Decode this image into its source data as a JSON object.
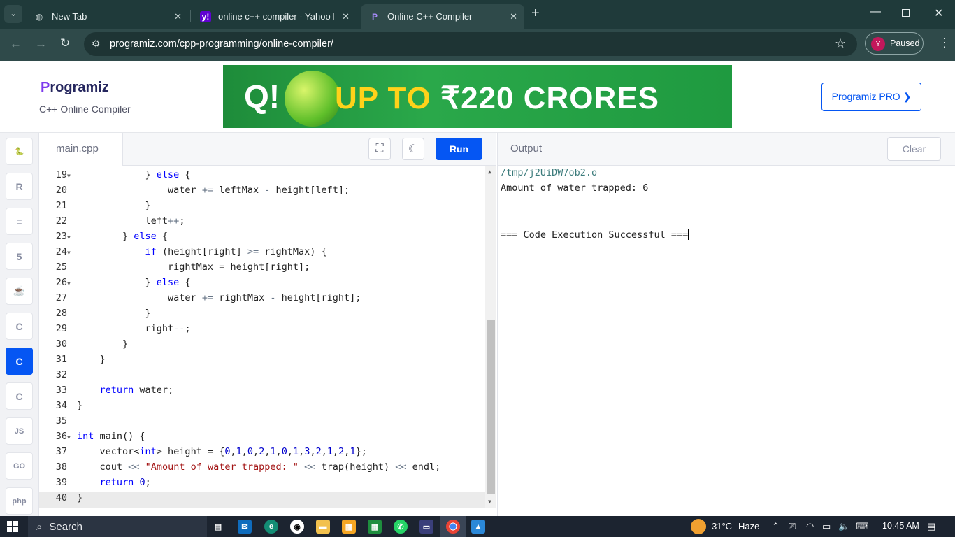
{
  "browser": {
    "tabs": [
      {
        "title": "New Tab",
        "icon": "globe-icon"
      },
      {
        "title": "online c++ compiler - Yahoo In",
        "icon": "yahoo-icon"
      },
      {
        "title": "Online C++ Compiler",
        "icon": "programiz-icon",
        "active": true
      }
    ],
    "new_tab": "+",
    "url": "programiz.com/cpp-programming/online-compiler/",
    "profile_initial": "Y",
    "profile_status": "Paused"
  },
  "site": {
    "logo_p": "P",
    "logo_rest": "rogramiz",
    "subtitle": "C++ Online Compiler",
    "ad_text_yellow": "UP TO",
    "ad_text_white": "₹220 CRORES",
    "ad_logo": "Q!",
    "pro_button": "Programiz PRO ❯"
  },
  "editor": {
    "filename": "main.cpp",
    "run_label": "Run",
    "lines": [
      {
        "n": "19",
        "fold": true
      },
      {
        "n": "20",
        "fold": false
      },
      {
        "n": "21",
        "fold": false
      },
      {
        "n": "22",
        "fold": false
      },
      {
        "n": "23",
        "fold": true
      },
      {
        "n": "24",
        "fold": true
      },
      {
        "n": "25",
        "fold": false
      },
      {
        "n": "26",
        "fold": true
      },
      {
        "n": "27",
        "fold": false
      },
      {
        "n": "28",
        "fold": false
      },
      {
        "n": "29",
        "fold": false
      },
      {
        "n": "30",
        "fold": false
      },
      {
        "n": "31",
        "fold": false
      },
      {
        "n": "32",
        "fold": false
      },
      {
        "n": "33",
        "fold": false
      },
      {
        "n": "34",
        "fold": false
      },
      {
        "n": "35",
        "fold": false
      },
      {
        "n": "36",
        "fold": true
      },
      {
        "n": "37",
        "fold": false
      },
      {
        "n": "38",
        "fold": false
      },
      {
        "n": "39",
        "fold": false
      },
      {
        "n": "40",
        "fold": false
      }
    ],
    "code": [
      "            } else {",
      "                water += leftMax - height[left];",
      "            }",
      "            left++;",
      "        } else {",
      "            if (height[right] >= rightMax) {",
      "                rightMax = height[right];",
      "            } else {",
      "                water += rightMax - height[right];",
      "            }",
      "            right--;",
      "        }",
      "    }",
      "",
      "    return water;",
      "}",
      "",
      "int main() {",
      "    vector<int> height = {0,1,0,2,1,0,1,3,2,1,2,1};",
      "    cout << \"Amount of water trapped: \" << trap(height) << endl;",
      "    return 0;",
      "}"
    ]
  },
  "output": {
    "label": "Output",
    "clear_label": "Clear",
    "lines": [
      "/tmp/j2UiDW7ob2.o",
      "Amount of water trapped: 6",
      "",
      "",
      "=== Code Execution Successful ==="
    ]
  },
  "taskbar": {
    "search_label": "Search",
    "weather_temp": "31°C",
    "weather_desc": "Haze",
    "clock": "10:45 AM"
  },
  "sidebar_langs": [
    {
      "name": "python-icon",
      "glyph": "🐍"
    },
    {
      "name": "r-icon",
      "glyph": "R"
    },
    {
      "name": "sql-icon",
      "glyph": "≡"
    },
    {
      "name": "html-icon",
      "glyph": "5"
    },
    {
      "name": "java-icon",
      "glyph": "☕"
    },
    {
      "name": "c-icon",
      "glyph": "C"
    },
    {
      "name": "cpp-icon",
      "glyph": "C",
      "active": true
    },
    {
      "name": "csharp-icon",
      "glyph": "C"
    },
    {
      "name": "js-icon",
      "glyph": "JS"
    },
    {
      "name": "go-icon",
      "glyph": "GO"
    },
    {
      "name": "php-icon",
      "glyph": "php"
    }
  ]
}
